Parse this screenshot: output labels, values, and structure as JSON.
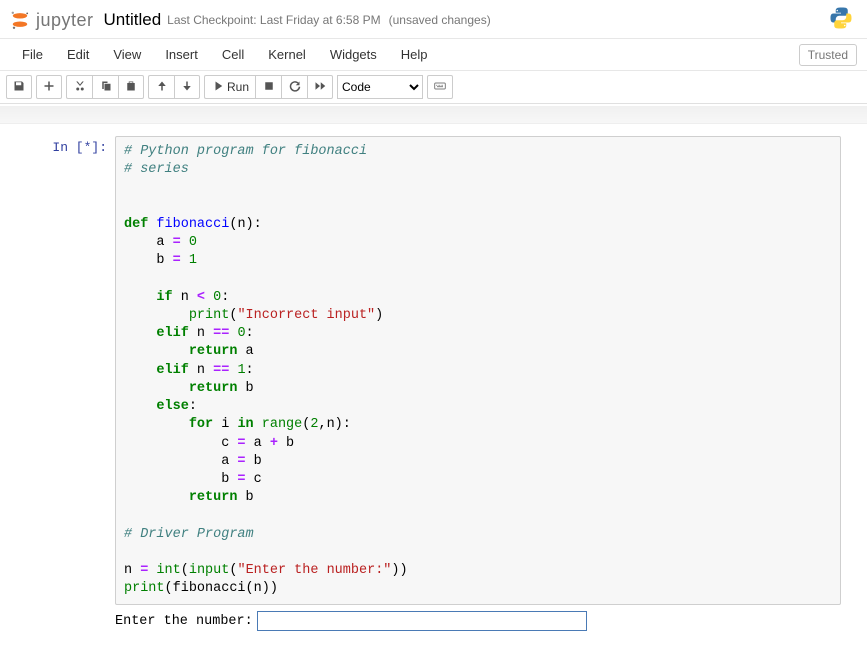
{
  "header": {
    "logo_text": "jupyter",
    "notebook_name": "Untitled",
    "checkpoint": "Last Checkpoint: Last Friday at 6:58 PM",
    "unsaved": "(unsaved changes)"
  },
  "menubar": {
    "items": [
      "File",
      "Edit",
      "View",
      "Insert",
      "Cell",
      "Kernel",
      "Widgets",
      "Help"
    ],
    "trusted": "Trusted"
  },
  "toolbar": {
    "run_label": "Run",
    "cell_type_selected": "Code"
  },
  "cell": {
    "prompt": "In [*]:",
    "code_lines": [
      {
        "t": "comment",
        "s": "# Python program for fibonacci"
      },
      {
        "t": "comment",
        "s": "# series"
      },
      {
        "t": "blank",
        "s": ""
      },
      {
        "t": "blank",
        "s": ""
      },
      {
        "t": "def",
        "kw": "def",
        "name": "fibonacci",
        "rest": "(n):"
      },
      {
        "t": "assign",
        "indent": "    ",
        "lhs": "a",
        "rhs": "0"
      },
      {
        "t": "assign",
        "indent": "    ",
        "lhs": "b",
        "rhs": "1"
      },
      {
        "t": "blank",
        "s": ""
      },
      {
        "t": "ifcmp",
        "indent": "    ",
        "kw": "if",
        "var": "n",
        "op": "<",
        "val": "0",
        "tail": ":"
      },
      {
        "t": "print",
        "indent": "        ",
        "text": "\"Incorrect input\""
      },
      {
        "t": "elifcmp",
        "indent": "    ",
        "kw": "elif",
        "var": "n",
        "op": "==",
        "val": "0",
        "tail": ":"
      },
      {
        "t": "return",
        "indent": "        ",
        "kw": "return",
        "var": "a"
      },
      {
        "t": "elifcmp",
        "indent": "    ",
        "kw": "elif",
        "var": "n",
        "op": "==",
        "val": "1",
        "tail": ":"
      },
      {
        "t": "return",
        "indent": "        ",
        "kw": "return",
        "var": "b"
      },
      {
        "t": "else",
        "indent": "    ",
        "kw": "else",
        "tail": ":"
      },
      {
        "t": "for",
        "indent": "        ",
        "kw": "for",
        "var": "i",
        "kw2": "in",
        "fn": "range",
        "args": "(",
        "n1": "2",
        "comma": ",n):"
      },
      {
        "t": "assign3",
        "indent": "            ",
        "lhs": "c",
        "rhs": "a + b"
      },
      {
        "t": "assign2",
        "indent": "            ",
        "lhs": "a",
        "rhs": "b"
      },
      {
        "t": "assign2",
        "indent": "            ",
        "lhs": "b",
        "rhs": "c"
      },
      {
        "t": "return",
        "indent": "        ",
        "kw": "return",
        "var": "b"
      },
      {
        "t": "blank",
        "s": ""
      },
      {
        "t": "comment",
        "s": "# Driver Program"
      },
      {
        "t": "blank",
        "s": ""
      },
      {
        "t": "inputline",
        "lhs": "n",
        "fn1": "int",
        "fn2": "input",
        "str": "\"Enter the number:\""
      },
      {
        "t": "printcall",
        "fn": "print",
        "inner": "fibonacci(n)"
      }
    ]
  },
  "output": {
    "prompt_text": "Enter the number:",
    "input_value": ""
  }
}
